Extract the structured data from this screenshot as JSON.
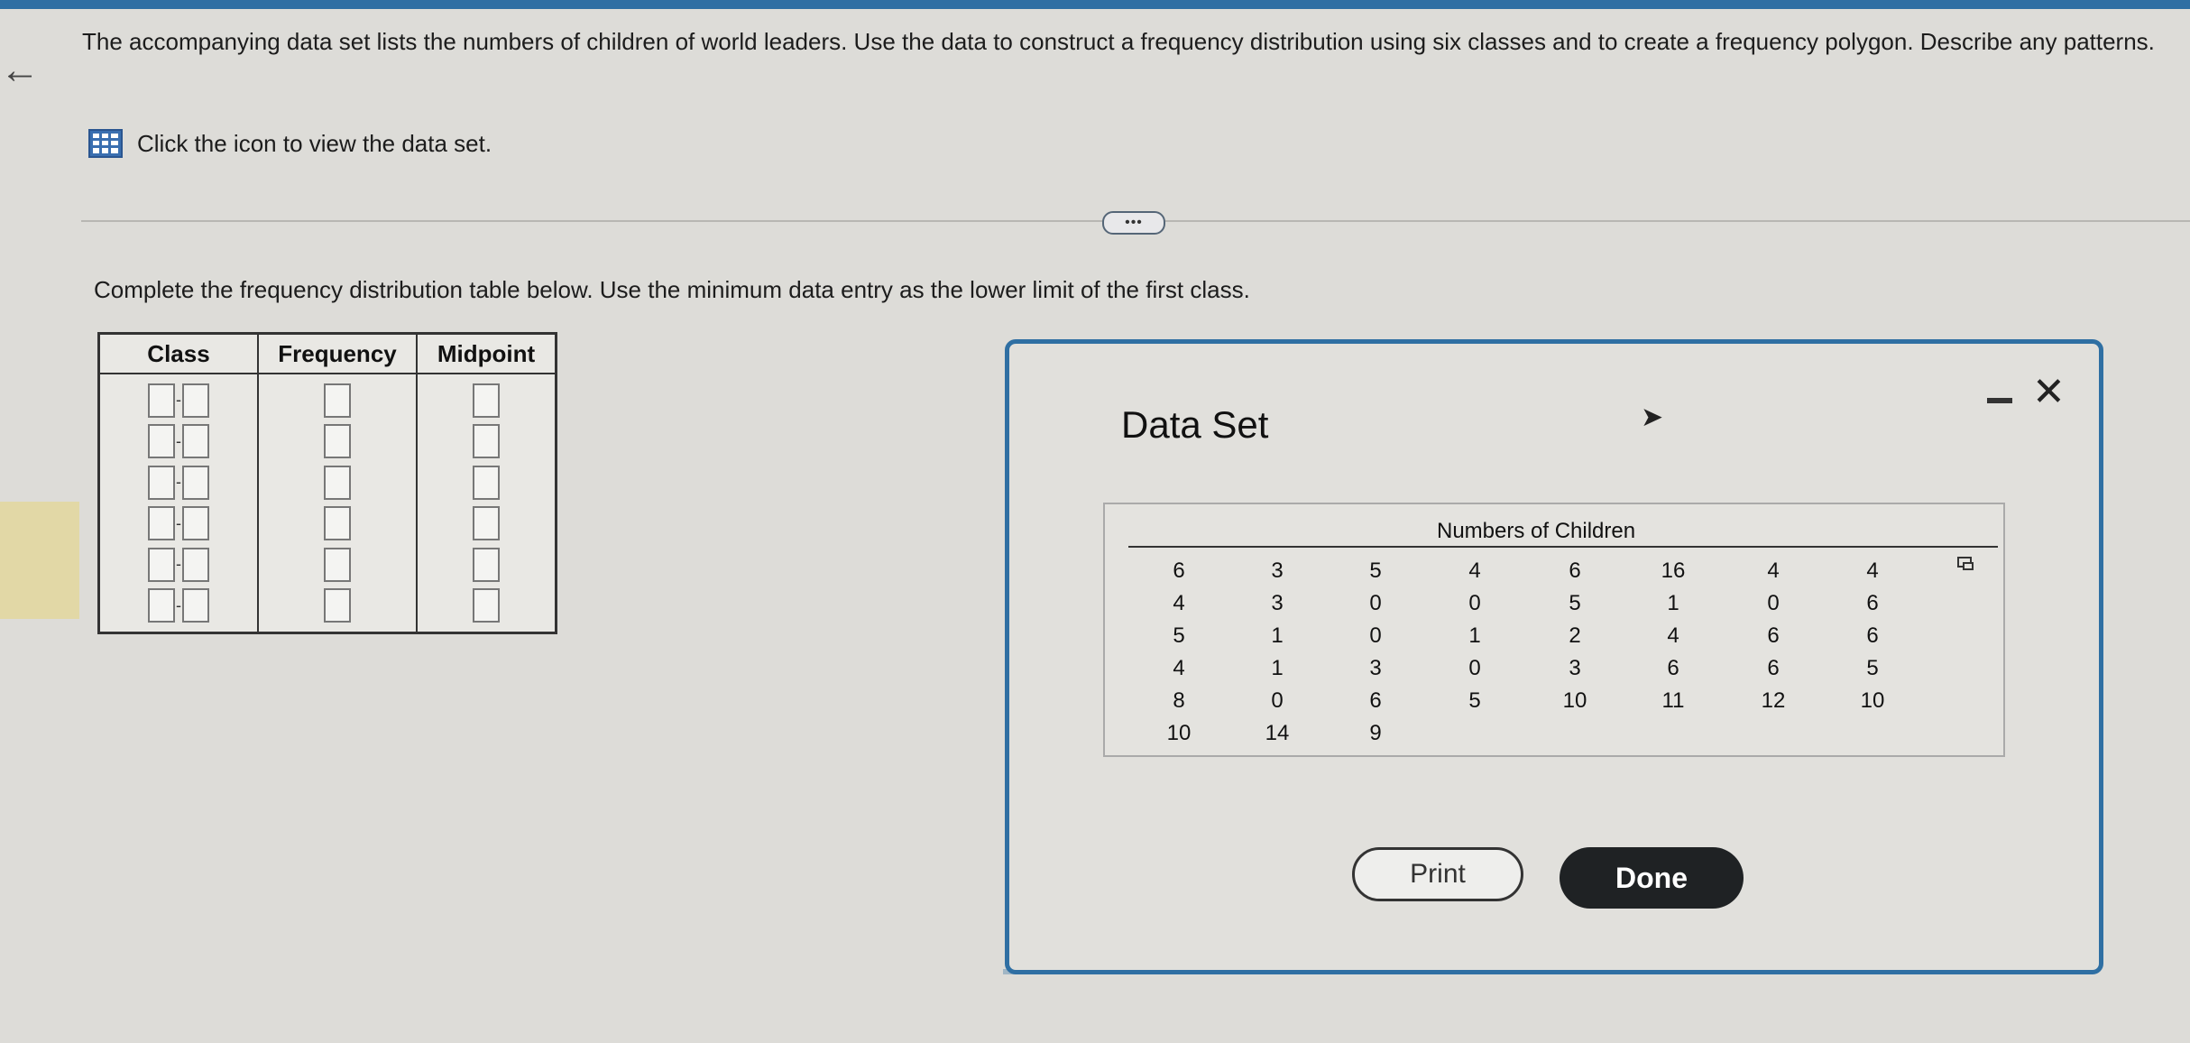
{
  "question": {
    "text": "The accompanying data set lists the numbers of children of world leaders. Use the data to construct a frequency distribution using six classes and to create a frequency polygon. Describe any patterns."
  },
  "dataset_link": {
    "label": "Click the icon to view the data set.",
    "icon": "grid-table-icon"
  },
  "more_button": {
    "label": "•••"
  },
  "instruction": "Complete the frequency distribution table below. Use the minimum data entry as the lower limit of the first class.",
  "freq_table": {
    "headers": [
      "Class",
      "Frequency",
      "Midpoint"
    ],
    "rows": 6,
    "class_separator": "-"
  },
  "dialog": {
    "title": "Data Set",
    "data_heading": "Numbers of Children",
    "columns": [
      [
        "6",
        "4",
        "5",
        "4",
        "8",
        "10"
      ],
      [
        "3",
        "3",
        "1",
        "1",
        "0",
        "14"
      ],
      [
        "5",
        "0",
        "0",
        "3",
        "6",
        "9"
      ],
      [
        "4",
        "0",
        "1",
        "0",
        "5"
      ],
      [
        "6",
        "5",
        "2",
        "3",
        "10"
      ],
      [
        "16",
        "1",
        "4",
        "6",
        "11"
      ],
      [
        "4",
        "0",
        "6",
        "6",
        "12"
      ],
      [
        "4",
        "6",
        "6",
        "5",
        "10"
      ]
    ],
    "print_label": "Print",
    "done_label": "Done",
    "close_icon": "close-icon",
    "minimize_icon": "minimize-icon"
  },
  "colors": {
    "accent": "#2f6fa3",
    "background": "#dddcd8",
    "done_button": "#1f2224"
  }
}
